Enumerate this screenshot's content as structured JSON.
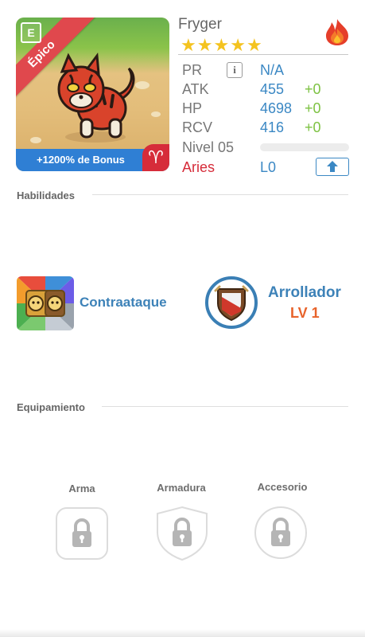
{
  "monster": {
    "name": "Fryger",
    "stars": 5,
    "star_glyph": "★",
    "rarity_label": "Épico",
    "rarity_badge": "E",
    "bonus_label": "+1200% de Bonus",
    "zodiac_symbol": "♈",
    "element_icon": "fire-element-icon",
    "element_color": "#e53e2a"
  },
  "stats": {
    "pr_label": "PR",
    "pr_value": "N/A",
    "info_glyph": "i",
    "atk_label": "ATK",
    "atk_value": "455",
    "atk_plus": "+0",
    "hp_label": "HP",
    "hp_value": "4698",
    "hp_plus": "+0",
    "rcv_label": "RCV",
    "rcv_value": "416",
    "rcv_plus": "+0",
    "level_label": "Nivel 05",
    "level_progress": 0,
    "zodiac_label": "Aries",
    "zodiac_level": "L0",
    "upgrade_icon": "arrow-up-icon"
  },
  "skills_section": {
    "title": "Habilidades",
    "skills": [
      {
        "name": "Contraataque",
        "icon": "counterattack-skill-icon"
      },
      {
        "name": "Arrollador",
        "level": "LV 1",
        "icon": "shield-skill-icon"
      }
    ]
  },
  "equipment_section": {
    "title": "Equipamiento",
    "slots": [
      {
        "label": "Arma",
        "icon": "lock-icon",
        "shape": "rounded-square"
      },
      {
        "label": "Armadura",
        "icon": "lock-icon",
        "shape": "shield"
      },
      {
        "label": "Accesorio",
        "icon": "lock-icon",
        "shape": "circle"
      }
    ]
  },
  "colors": {
    "accent_blue": "#3b88c4",
    "positive_green": "#7dc242",
    "aries_red": "#d62c3a",
    "star_yellow": "#f4c31f",
    "rarity_red": "#e0484d",
    "level_orange": "#e8632b"
  }
}
